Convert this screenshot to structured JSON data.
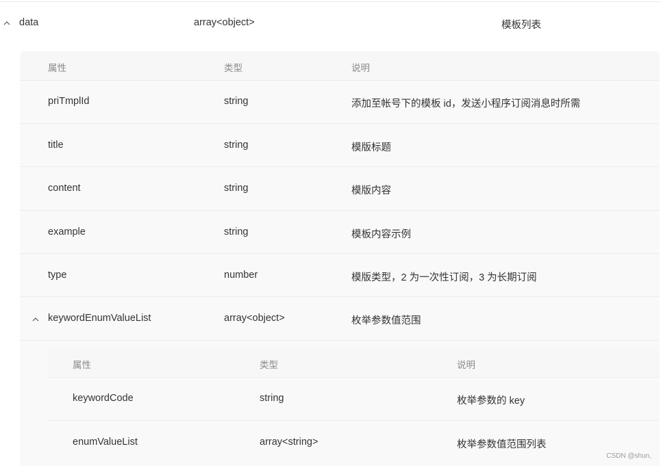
{
  "root": {
    "name": "data",
    "type": "array<object>",
    "desc": "模板列表"
  },
  "level1": {
    "headers": {
      "name": "属性",
      "type": "类型",
      "desc": "说明"
    },
    "rows": [
      {
        "name": "priTmplId",
        "type": "string",
        "desc": "添加至帐号下的模板 id，发送小程序订阅消息时所需"
      },
      {
        "name": "title",
        "type": "string",
        "desc": "模版标题"
      },
      {
        "name": "content",
        "type": "string",
        "desc": "模版内容"
      },
      {
        "name": "example",
        "type": "string",
        "desc": "模板内容示例"
      },
      {
        "name": "type",
        "type": "number",
        "desc": "模版类型，2 为一次性订阅，3 为长期订阅"
      },
      {
        "name": "keywordEnumValueList",
        "type": "array<object>",
        "desc": "枚举参数值范围"
      }
    ]
  },
  "level2": {
    "headers": {
      "name": "属性",
      "type": "类型",
      "desc": "说明"
    },
    "rows": [
      {
        "name": "keywordCode",
        "type": "string",
        "desc": "枚举参数的 key"
      },
      {
        "name": "enumValueList",
        "type": "array<string>",
        "desc": "枚举参数值范围列表"
      }
    ]
  },
  "icons": {
    "toggle": "chevron-up-icon"
  },
  "watermark": "CSDN @shun,",
  "colors": {
    "header_text": "#8a8a8a",
    "body_text": "#333333",
    "table_bg": "#f9f9f9",
    "divider": "#ebebeb"
  }
}
